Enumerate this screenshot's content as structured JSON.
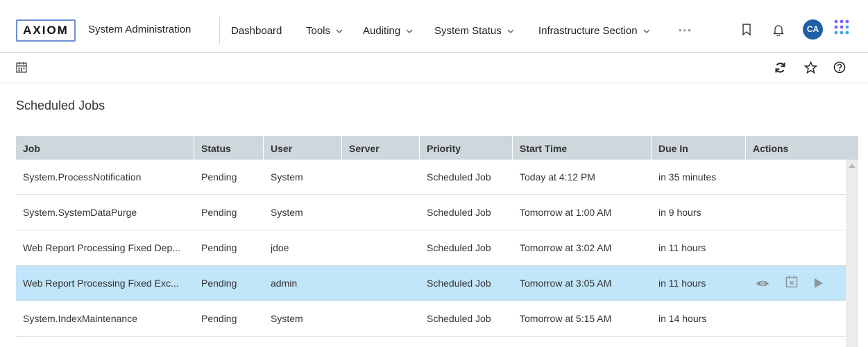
{
  "header": {
    "logo": "AXIOM",
    "app_title": "System Administration",
    "nav": [
      {
        "label": "Dashboard",
        "dropdown": false
      },
      {
        "label": "Tools",
        "dropdown": true
      },
      {
        "label": "Auditing",
        "dropdown": true
      },
      {
        "label": "System Status",
        "dropdown": true
      },
      {
        "label": "Infrastructure Section",
        "dropdown": true
      }
    ],
    "more": "•••",
    "avatar_initials": "CA",
    "icons": [
      "bookmark-icon",
      "bell-icon",
      "apps-grid-icon"
    ]
  },
  "toolbar": {
    "left_icon": "calendar-icon",
    "right_icons": [
      "refresh-icon",
      "star-icon",
      "help-icon"
    ]
  },
  "page": {
    "title": "Scheduled Jobs"
  },
  "table": {
    "columns": [
      "Job",
      "Status",
      "User",
      "Server",
      "Priority",
      "Start Time",
      "Due In",
      "Actions"
    ],
    "rows": [
      {
        "job": "System.ProcessNotification",
        "status": "Pending",
        "user": "System",
        "server": "",
        "priority": "Scheduled Job",
        "start": "Today at 4:12 PM",
        "due": "in 35 minutes"
      },
      {
        "job": "System.SystemDataPurge",
        "status": "Pending",
        "user": "System",
        "server": "",
        "priority": "Scheduled Job",
        "start": "Tomorrow at 1:00 AM",
        "due": "in 9 hours"
      },
      {
        "job": "Web Report Processing Fixed Dep...",
        "status": "Pending",
        "user": "jdoe",
        "server": "",
        "priority": "Scheduled Job",
        "start": "Tomorrow at 3:02 AM",
        "due": "in 11 hours"
      },
      {
        "job": "Web Report Processing Fixed Exc...",
        "status": "Pending",
        "user": "admin",
        "server": "",
        "priority": "Scheduled Job",
        "start": "Tomorrow at 3:05 AM",
        "due": "in 11 hours",
        "selected": true
      },
      {
        "job": "System.IndexMaintenance",
        "status": "Pending",
        "user": "System",
        "server": "",
        "priority": "Scheduled Job",
        "start": "Tomorrow at 5:15 AM",
        "due": "in 14 hours"
      }
    ],
    "row_actions": [
      "view-icon",
      "cancel-schedule-icon",
      "run-icon"
    ]
  },
  "colors": {
    "header_bg": "#cdd7dc",
    "selected_row": "#c1e5f9",
    "avatar": "#1e5fa8",
    "apps_icon": "#7b61ff"
  }
}
